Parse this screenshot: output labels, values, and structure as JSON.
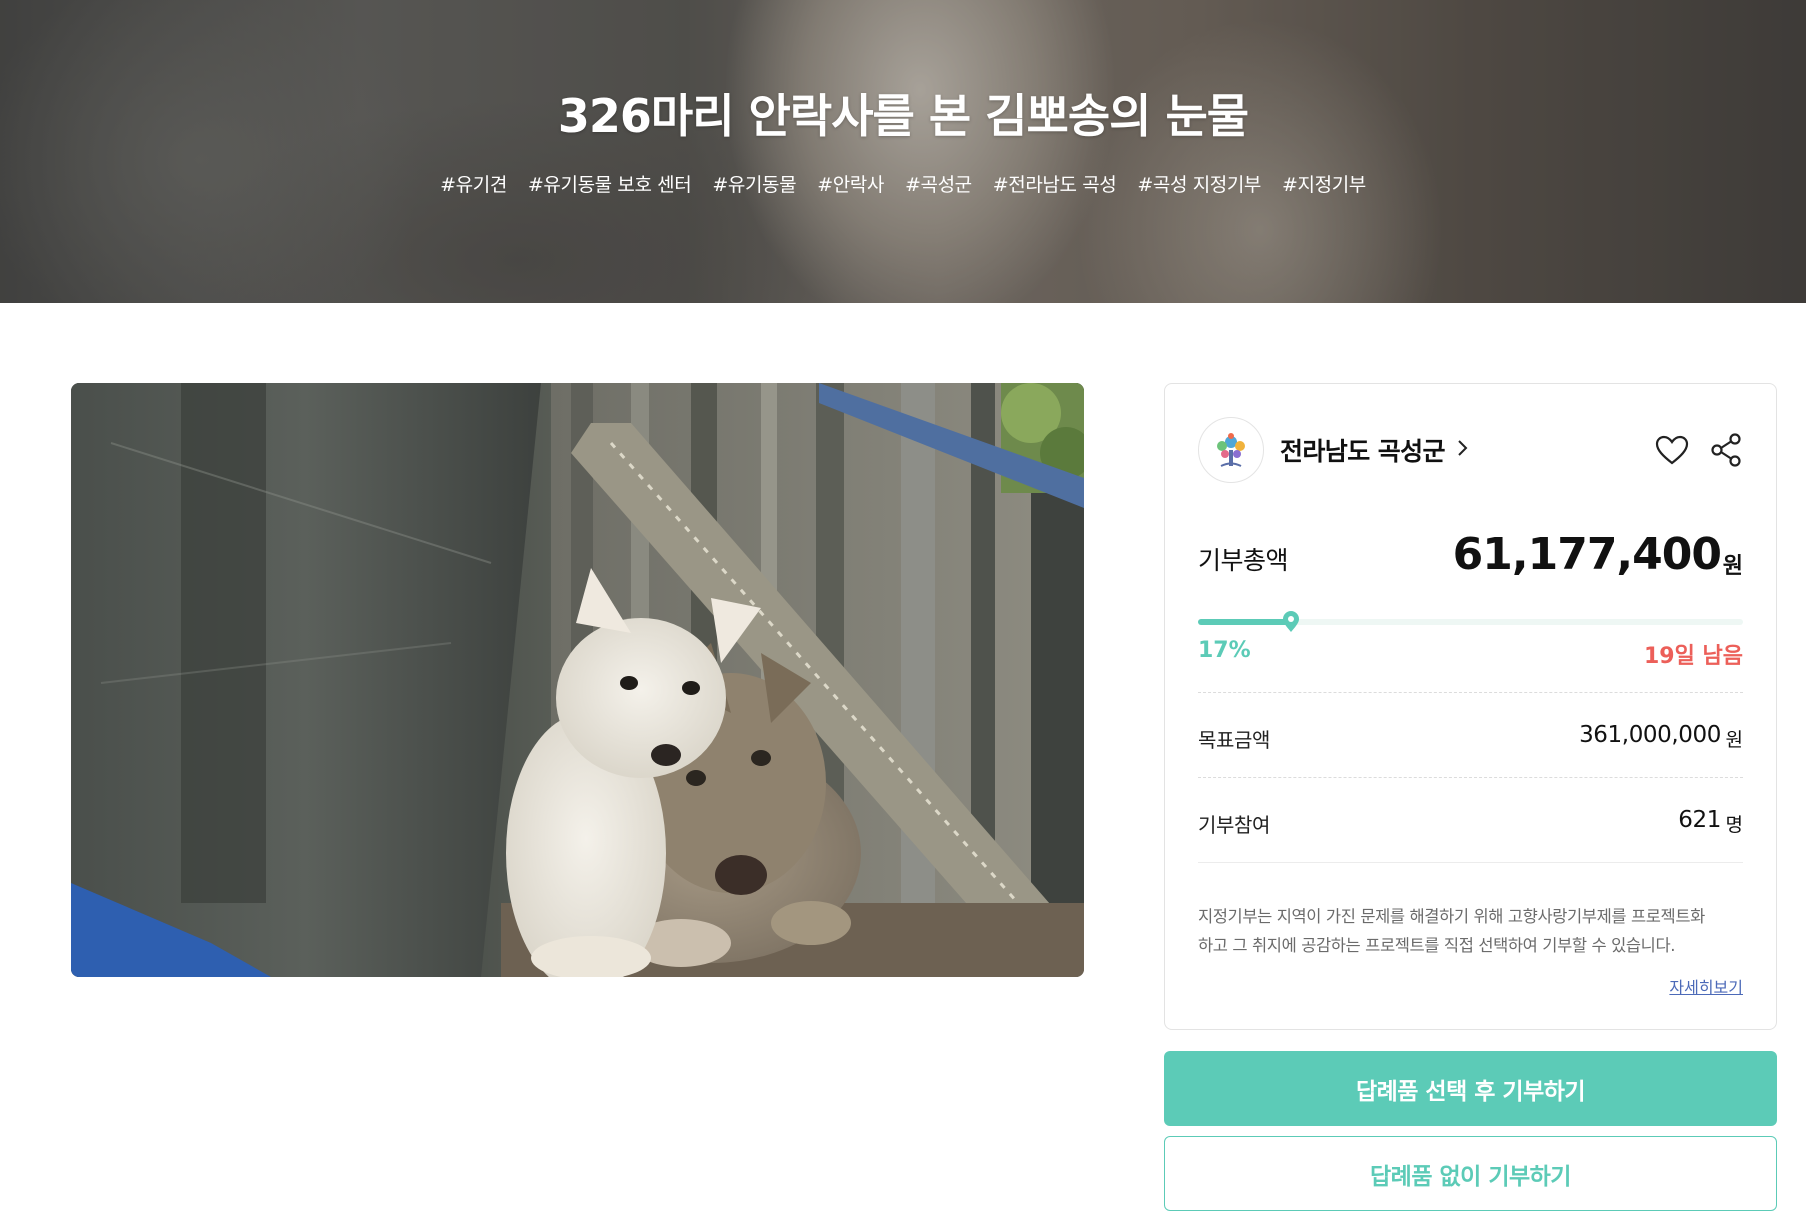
{
  "hero": {
    "title": "326마리 안락사를 본 김뽀송의 눈물",
    "tags": [
      "#유기견",
      "#유기동물 보호 센터",
      "#유기동물",
      "#안락사",
      "#곡성군",
      "#전라남도 곡성",
      "#곡성 지정기부",
      "#지정기부"
    ]
  },
  "panel": {
    "org_name": "전라남도 곡성군",
    "total_label": "기부총액",
    "total_value": "61,177,400",
    "total_unit": "원",
    "progress_fraction": 0.17,
    "progress_label": "17%",
    "remaining_label": "19일 남음",
    "goal_label": "목표금액",
    "goal_value": "361,000,000",
    "goal_unit": "원",
    "participants_label": "기부참여",
    "participants_value": "621",
    "participants_unit": "명",
    "description_line1": "지정기부는 지역이 가진 문제를 해결하기 위해 고향사랑기부제를 프로젝트화",
    "description_line2": "하고 그 취지에 공감하는 프로젝트를 직접 선택하여 기부할 수 있습니다.",
    "more_link": "자세히보기"
  },
  "buttons": {
    "donate_with_gift": "답례품 선택 후 기부하기",
    "donate_without_gift": "답례품 없이 기부하기"
  },
  "colors": {
    "accent": "#5ccbb7",
    "remaining": "#ec5f59",
    "link": "#4c6ab8"
  },
  "icons": {
    "heart": "heart-icon",
    "share": "share-icon",
    "chevron": "chevron-right-icon",
    "logo": "tree-logo-icon"
  }
}
